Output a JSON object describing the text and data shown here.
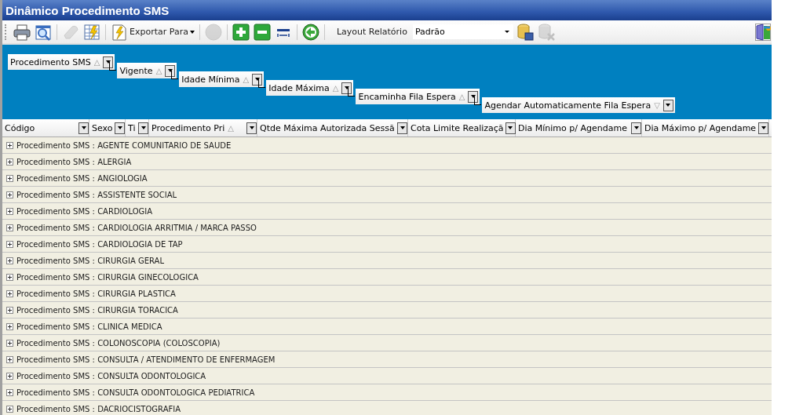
{
  "window": {
    "title": "Dinâmico Procedimento SMS"
  },
  "toolbar": {
    "items": [
      {
        "kind": "print",
        "disabled": false
      },
      {
        "kind": "preview",
        "disabled": false
      },
      {
        "kind": "eraser",
        "disabled": true
      },
      {
        "kind": "sheet",
        "disabled": false
      },
      {
        "kind": "export",
        "disabled": false,
        "label": "Exportar Para"
      },
      {
        "kind": "ball",
        "disabled": true
      },
      {
        "kind": "plus",
        "disabled": false
      },
      {
        "kind": "minus",
        "disabled": false
      },
      {
        "kind": "columns",
        "disabled": false
      },
      {
        "kind": "back",
        "disabled": false
      }
    ],
    "layout_label": "Layout Relatório",
    "layout_value": "Padrão",
    "db_items": [
      {
        "kind": "save",
        "disabled": false
      },
      {
        "kind": "delete",
        "disabled": true
      }
    ]
  },
  "group_by": [
    {
      "label": "Procedimento SMS",
      "sort_icon": "△"
    },
    {
      "label": "Vigente",
      "sort_icon": "△"
    },
    {
      "label": "Idade Mínima",
      "sort_icon": "△"
    },
    {
      "label": "Idade Máxima",
      "sort_icon": "△"
    },
    {
      "label": "Encaminha Fila Espera",
      "sort_icon": "△"
    },
    {
      "label": "Agendar Automaticamente Fila Espera",
      "sort_icon": "▽"
    }
  ],
  "table": {
    "columns": [
      {
        "label": "Código"
      },
      {
        "label": "Sexo"
      },
      {
        "label": "Ti"
      },
      {
        "label": "Procedimento Pri",
        "sort_icon": "△"
      },
      {
        "label": "Qtde Máxima Autorizada Sessã"
      },
      {
        "label": "Cota Limite Realizaçã"
      },
      {
        "label": "Dia Mínimo p/ Agendame"
      },
      {
        "label": "Dia Máximo p/ Agendame"
      }
    ],
    "rows": [
      {
        "text": "Procedimento SMS : AGENTE COMUNITARIO DE SAUDE",
        "expanded": false
      },
      {
        "text": "Procedimento SMS : ALERGIA",
        "expanded": false
      },
      {
        "text": "Procedimento SMS : ANGIOLOGIA",
        "expanded": false
      },
      {
        "text": "Procedimento SMS : ASSISTENTE SOCIAL",
        "expanded": false
      },
      {
        "text": "Procedimento SMS : CARDIOLOGIA",
        "expanded": false
      },
      {
        "text": "Procedimento SMS : CARDIOLOGIA ARRITMIA / MARCA PASSO",
        "expanded": false
      },
      {
        "text": "Procedimento SMS : CARDIOLOGIA DE TAP",
        "expanded": false
      },
      {
        "text": "Procedimento SMS : CIRURGIA GERAL",
        "expanded": false
      },
      {
        "text": "Procedimento SMS : CIRURGIA GINECOLOGICA",
        "expanded": false
      },
      {
        "text": "Procedimento SMS : CIRURGIA PLASTICA",
        "expanded": false
      },
      {
        "text": "Procedimento SMS : CIRURGIA TORACICA",
        "expanded": false
      },
      {
        "text": "Procedimento SMS : CLINICA MEDICA",
        "expanded": false
      },
      {
        "text": "Procedimento SMS : COLONOSCOPIA (COLOSCOPIA)",
        "expanded": false
      },
      {
        "text": "Procedimento SMS : CONSULTA / ATENDIMENTO DE ENFERMAGEM",
        "expanded": false
      },
      {
        "text": "Procedimento SMS : CONSULTA ODONTOLOGICA",
        "expanded": false
      },
      {
        "text": "Procedimento SMS : CONSULTA ODONTOLOGICA PEDIATRICA",
        "expanded": false
      },
      {
        "text": "Procedimento SMS : DACRIOCISTOGRAFIA",
        "expanded": false
      }
    ]
  }
}
